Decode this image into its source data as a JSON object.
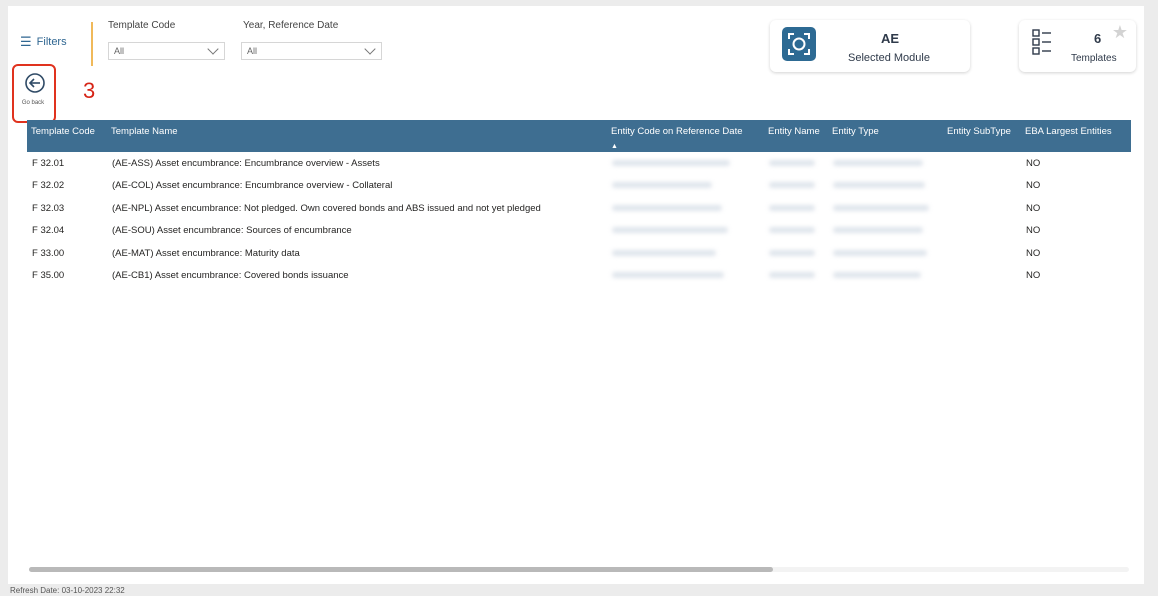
{
  "filters": {
    "button_label": "Filters",
    "slicers": [
      {
        "label": "Template Code",
        "value": "All"
      },
      {
        "label": "Year, Reference Date",
        "value": "All"
      }
    ]
  },
  "cards": {
    "module": {
      "value": "AE",
      "label": "Selected Module",
      "icon": "scan-icon"
    },
    "templates": {
      "value": "6",
      "label": "Templates",
      "icon": "list-icon"
    }
  },
  "go_back": {
    "label": "Go back",
    "step": "3"
  },
  "table": {
    "columns": [
      "Template Code",
      "Template Name",
      "Entity Code on Reference Date",
      "Entity Name",
      "Entity Type",
      "Entity SubType",
      "EBA Largest Entities"
    ],
    "rows": [
      {
        "code": "F 32.01",
        "name": "(AE-ASS) Asset encumbrance: Encumbrance overview - Assets",
        "eba": "NO"
      },
      {
        "code": "F 32.02",
        "name": "(AE-COL) Asset encumbrance: Encumbrance overview - Collateral",
        "eba": "NO"
      },
      {
        "code": "F 32.03",
        "name": "(AE-NPL) Asset encumbrance: Not pledged. Own covered bonds and ABS issued and not yet pledged",
        "eba": "NO"
      },
      {
        "code": "F 32.04",
        "name": "(AE-SOU) Asset encumbrance: Sources of encumbrance",
        "eba": "NO"
      },
      {
        "code": "F 33.00",
        "name": "(AE-MAT) Asset encumbrance: Maturity data",
        "eba": "NO"
      },
      {
        "code": "F 35.00",
        "name": "(AE-CB1) Asset encumbrance: Covered bonds issuance",
        "eba": "NO"
      }
    ]
  },
  "footer": {
    "refresh": "Refresh Date: 03-10-2023 22:32"
  },
  "colors": {
    "header_bg": "#3e6e91",
    "accent": "#2d6a93",
    "highlight": "#e0321e"
  }
}
